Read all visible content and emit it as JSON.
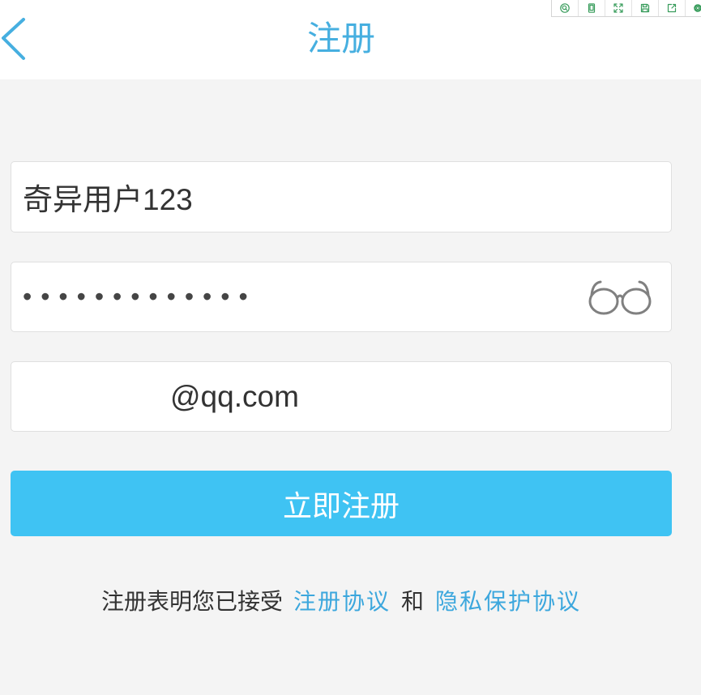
{
  "header": {
    "title": "注册",
    "back_icon": "chevron-left-icon"
  },
  "toolbar": {
    "items": [
      {
        "icon": "zoom-icon"
      },
      {
        "icon": "device-icon"
      },
      {
        "icon": "fullscreen-icon"
      },
      {
        "icon": "save-icon"
      },
      {
        "icon": "share-icon"
      },
      {
        "icon": "gear-icon"
      }
    ]
  },
  "form": {
    "username": {
      "value": "奇异用户123"
    },
    "password": {
      "masked_value": "•••••••••••••",
      "toggle_icon": "glasses-icon"
    },
    "email": {
      "suffix": "@qq.com"
    },
    "submit_label": "立即注册"
  },
  "agreement": {
    "prefix": "注册表明您已接受",
    "terms_link": "注册协议",
    "conjunction": "和",
    "privacy_link": "隐私保护协议"
  },
  "colors": {
    "accent": "#46afe0",
    "button": "#3fc3f3",
    "button_text": "#ffffff",
    "link": "#3ca7dd",
    "background": "#f4f4f4",
    "toolbar_icon": "#3a9d5d"
  }
}
